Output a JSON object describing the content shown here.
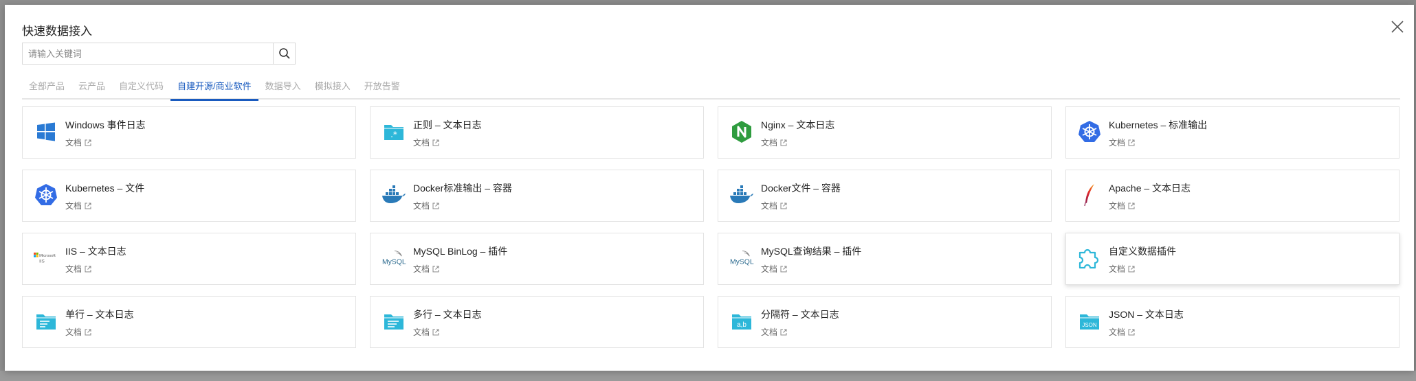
{
  "modal": {
    "title": "快速数据接入"
  },
  "search": {
    "placeholder": "请输入关键词",
    "value": ""
  },
  "tabs": [
    {
      "label": "全部产品",
      "active": false
    },
    {
      "label": "云产品",
      "active": false
    },
    {
      "label": "自定义代码",
      "active": false
    },
    {
      "label": "自建开源/商业软件",
      "active": true
    },
    {
      "label": "数据导入",
      "active": false
    },
    {
      "label": "模拟接入",
      "active": false
    },
    {
      "label": "开放告警",
      "active": false
    }
  ],
  "cards": [
    {
      "title": "Windows 事件日志",
      "doc": "文档",
      "icon": "windows-icon"
    },
    {
      "title": "正则 – 文本日志",
      "doc": "文档",
      "icon": "regex-folder-icon"
    },
    {
      "title": "Nginx – 文本日志",
      "doc": "文档",
      "icon": "nginx-icon"
    },
    {
      "title": "Kubernetes – 标准输出",
      "doc": "文档",
      "icon": "kubernetes-icon"
    },
    {
      "title": "Kubernetes – 文件",
      "doc": "文档",
      "icon": "kubernetes-icon"
    },
    {
      "title": "Docker标准输出 – 容器",
      "doc": "文档",
      "icon": "docker-icon"
    },
    {
      "title": "Docker文件 – 容器",
      "doc": "文档",
      "icon": "docker-icon"
    },
    {
      "title": "Apache – 文本日志",
      "doc": "文档",
      "icon": "apache-feather-icon"
    },
    {
      "title": "IIS – 文本日志",
      "doc": "文档",
      "icon": "microsoft-iis-icon",
      "logo_text": "IIS"
    },
    {
      "title": "MySQL BinLog – 插件",
      "doc": "文档",
      "icon": "mysql-icon",
      "logo_text": "MySQL"
    },
    {
      "title": "MySQL查询结果 – 插件",
      "doc": "文档",
      "icon": "mysql-icon",
      "logo_text": "MySQL"
    },
    {
      "title": "自定义数据插件",
      "doc": "文档",
      "icon": "puzzle-plugin-icon"
    },
    {
      "title": "单行 – 文本日志",
      "doc": "文档",
      "icon": "single-line-folder-icon"
    },
    {
      "title": "多行 – 文本日志",
      "doc": "文档",
      "icon": "multi-line-folder-icon"
    },
    {
      "title": "分隔符 – 文本日志",
      "doc": "文档",
      "icon": "delimiter-folder-icon",
      "logo_text": "a,b"
    },
    {
      "title": "JSON – 文本日志",
      "doc": "文档",
      "icon": "json-folder-icon",
      "logo_text": "JSON"
    }
  ],
  "colors": {
    "accent": "#1a5bbf",
    "folder": "#2db7d9",
    "nginx": "#2f9c3f",
    "kubernetes": "#326ce5",
    "docker": "#2a7ab8",
    "windows": "#2a7ad4"
  }
}
